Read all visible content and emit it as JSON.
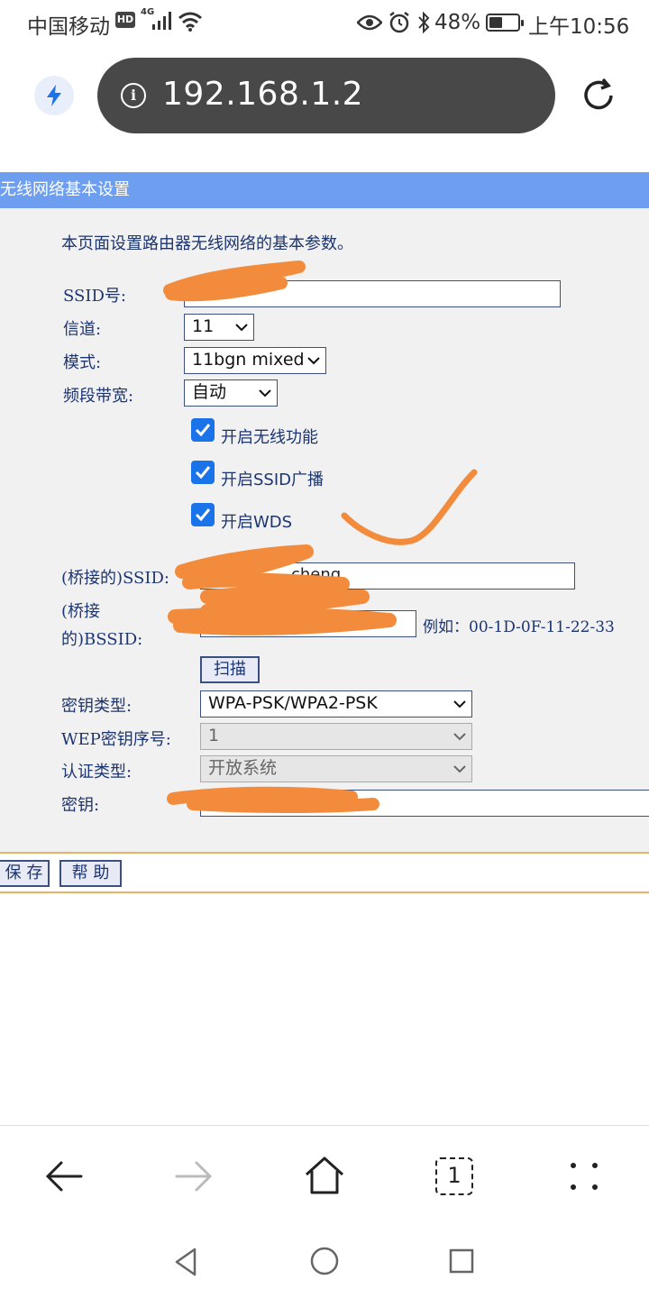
{
  "status_bar": {
    "carrier": "中国移动",
    "hd_badge": "HD",
    "network": "4G",
    "battery_percent": "48%",
    "battery_level": 0.48,
    "time": "上午10:56"
  },
  "browser": {
    "url": "192.168.1.2",
    "tab_count": "1"
  },
  "page": {
    "title": "无线网络基本设置",
    "intro": "本页面设置路由器无线网络的基本参数。",
    "fields": {
      "ssid_label": "SSID号:",
      "channel_label": "信道:",
      "channel_value": "11",
      "mode_label": "模式:",
      "mode_value": "11bgn mixed",
      "bandwidth_label": "频段带宽:",
      "bandwidth_value": "自动",
      "enable_wireless": "开启无线功能",
      "enable_ssid_broadcast": "开启SSID广播",
      "enable_wds": "开启WDS",
      "bridge_ssid_label": "(桥接的)SSID:",
      "bridge_ssid_value": "cheng",
      "bridge_bssid_label_1": "(桥接",
      "bridge_bssid_label_2": "的)BSSID:",
      "bssid_example": "例如：00-1D-0F-11-22-33",
      "scan_button": "扫描",
      "key_type_label": "密钥类型:",
      "key_type_value": "WPA-PSK/WPA2-PSK",
      "wep_index_label": "WEP密钥序号:",
      "wep_index_value": "1",
      "auth_type_label": "认证类型:",
      "auth_type_value": "开放系统",
      "key_label": "密钥:"
    },
    "buttons": {
      "save": "保 存",
      "help": "帮 助"
    }
  },
  "colors": {
    "title_bar": "#6d9eef",
    "checkbox": "#1a73e8",
    "annotation": "#f28c3c",
    "url_bar": "#484848"
  }
}
